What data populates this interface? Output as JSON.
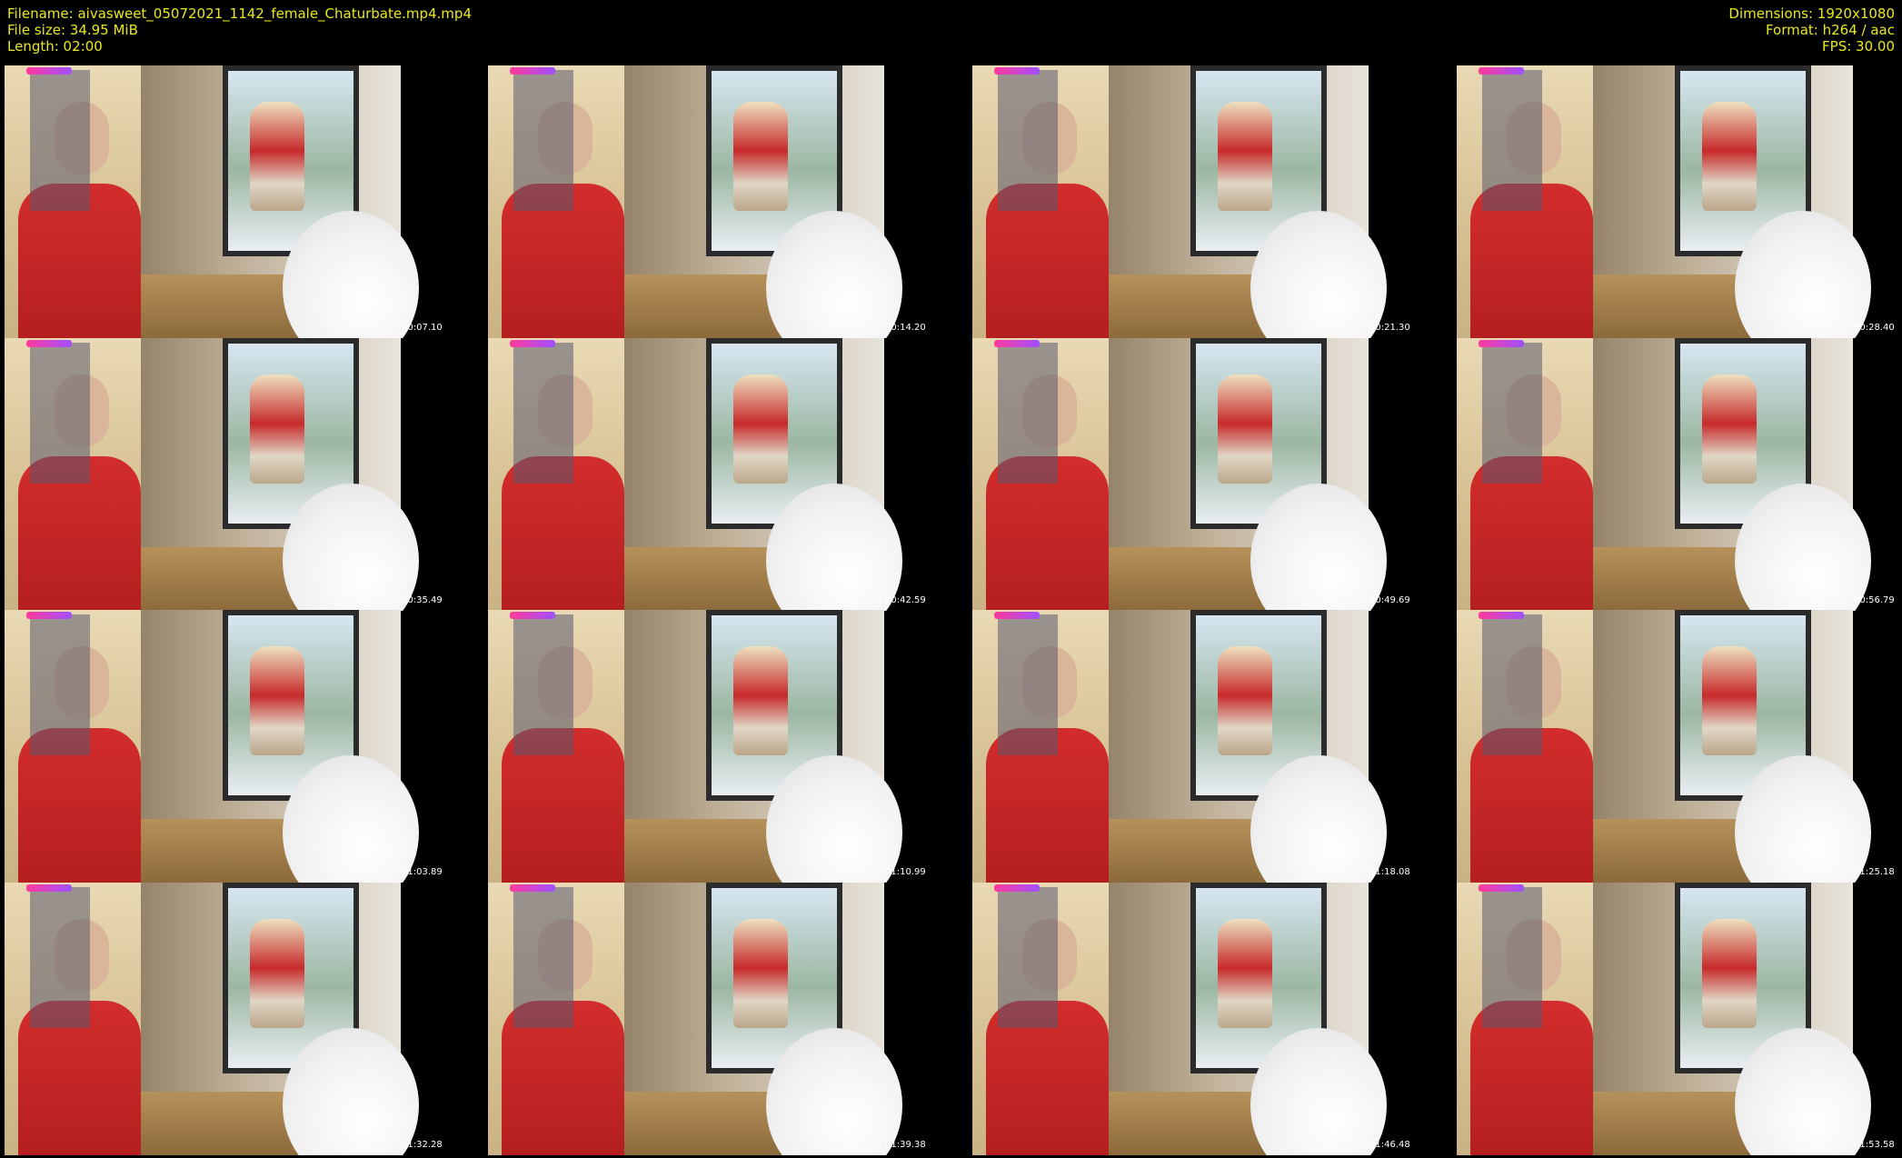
{
  "header": {
    "filename": "Filename: aivasweet_05072021_1142_female_Chaturbate.mp4.mp4",
    "filesize": "File size: 34.95 MiB",
    "length": "Length: 02:00",
    "dimensions": "Dimensions: 1920x1080",
    "format": "Format: h264 / aac",
    "fps": "FPS: 30.00"
  },
  "thumbnails": [
    {
      "timestamp": "00:07.10"
    },
    {
      "timestamp": "00:14.20"
    },
    {
      "timestamp": "00:21.30"
    },
    {
      "timestamp": "00:28.40"
    },
    {
      "timestamp": "00:35.49"
    },
    {
      "timestamp": "00:42.59"
    },
    {
      "timestamp": "00:49.69"
    },
    {
      "timestamp": "00:56.79"
    },
    {
      "timestamp": "01:03.89"
    },
    {
      "timestamp": "01:10.99"
    },
    {
      "timestamp": "01:18.08"
    },
    {
      "timestamp": "01:25.18"
    },
    {
      "timestamp": "01:32.28"
    },
    {
      "timestamp": "01:39.38"
    },
    {
      "timestamp": "01:46.48"
    },
    {
      "timestamp": "01:53.58"
    }
  ]
}
